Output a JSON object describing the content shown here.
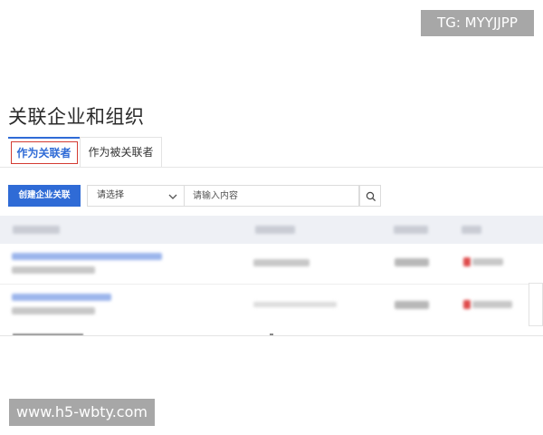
{
  "watermark_top": "TG: MYYJJPP",
  "watermark_bottom": "www.h5-wbty.com",
  "page": {
    "title": "关联企业和组织"
  },
  "tabs": [
    {
      "label": "作为关联者",
      "active": true
    },
    {
      "label": "作为被关联者",
      "active": false
    }
  ],
  "toolbar": {
    "create_label": "创建企业关联",
    "select_value": "请选择",
    "search_placeholder": "请输入内容"
  },
  "icons": {
    "select_chevron": "chevron-down-icon",
    "search": "search-icon"
  },
  "colors": {
    "primary": "#2f6bd6",
    "highlight_outline": "#d33b32",
    "table_header_bg": "#eef0f5",
    "status_red": "#df4b4b"
  }
}
